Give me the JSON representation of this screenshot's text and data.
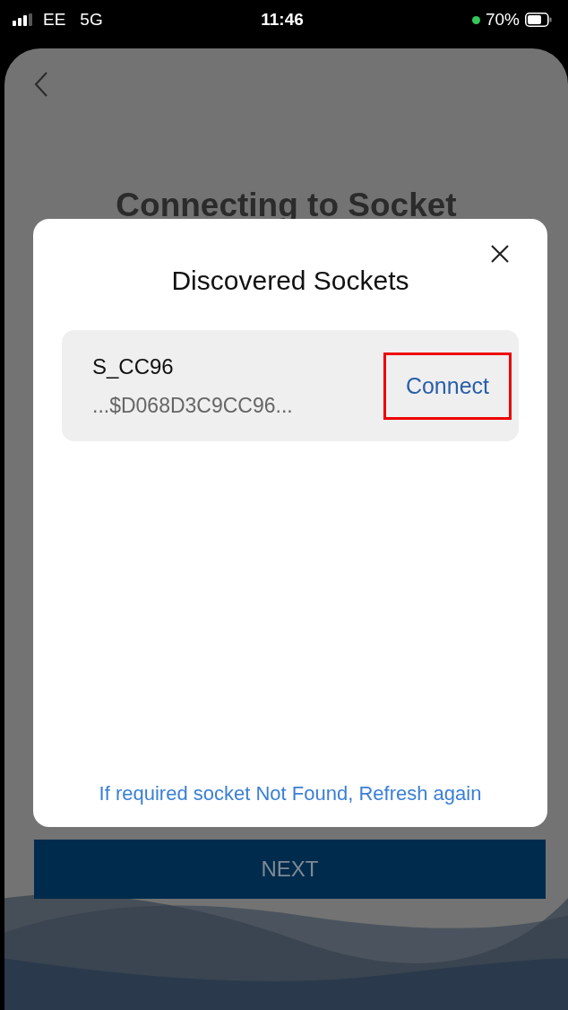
{
  "status_bar": {
    "carrier": "EE",
    "network": "5G",
    "time": "11:46",
    "battery": "70%"
  },
  "screen": {
    "title": "Connecting to Socket",
    "next_button": "NEXT"
  },
  "dialog": {
    "title": "Discovered Sockets",
    "sockets": [
      {
        "name": "S_CC96",
        "address": "...$D068D3C9CC96...",
        "action": "Connect",
        "highlighted": true
      }
    ],
    "footer_link": "If required socket Not Found, Refresh again"
  }
}
